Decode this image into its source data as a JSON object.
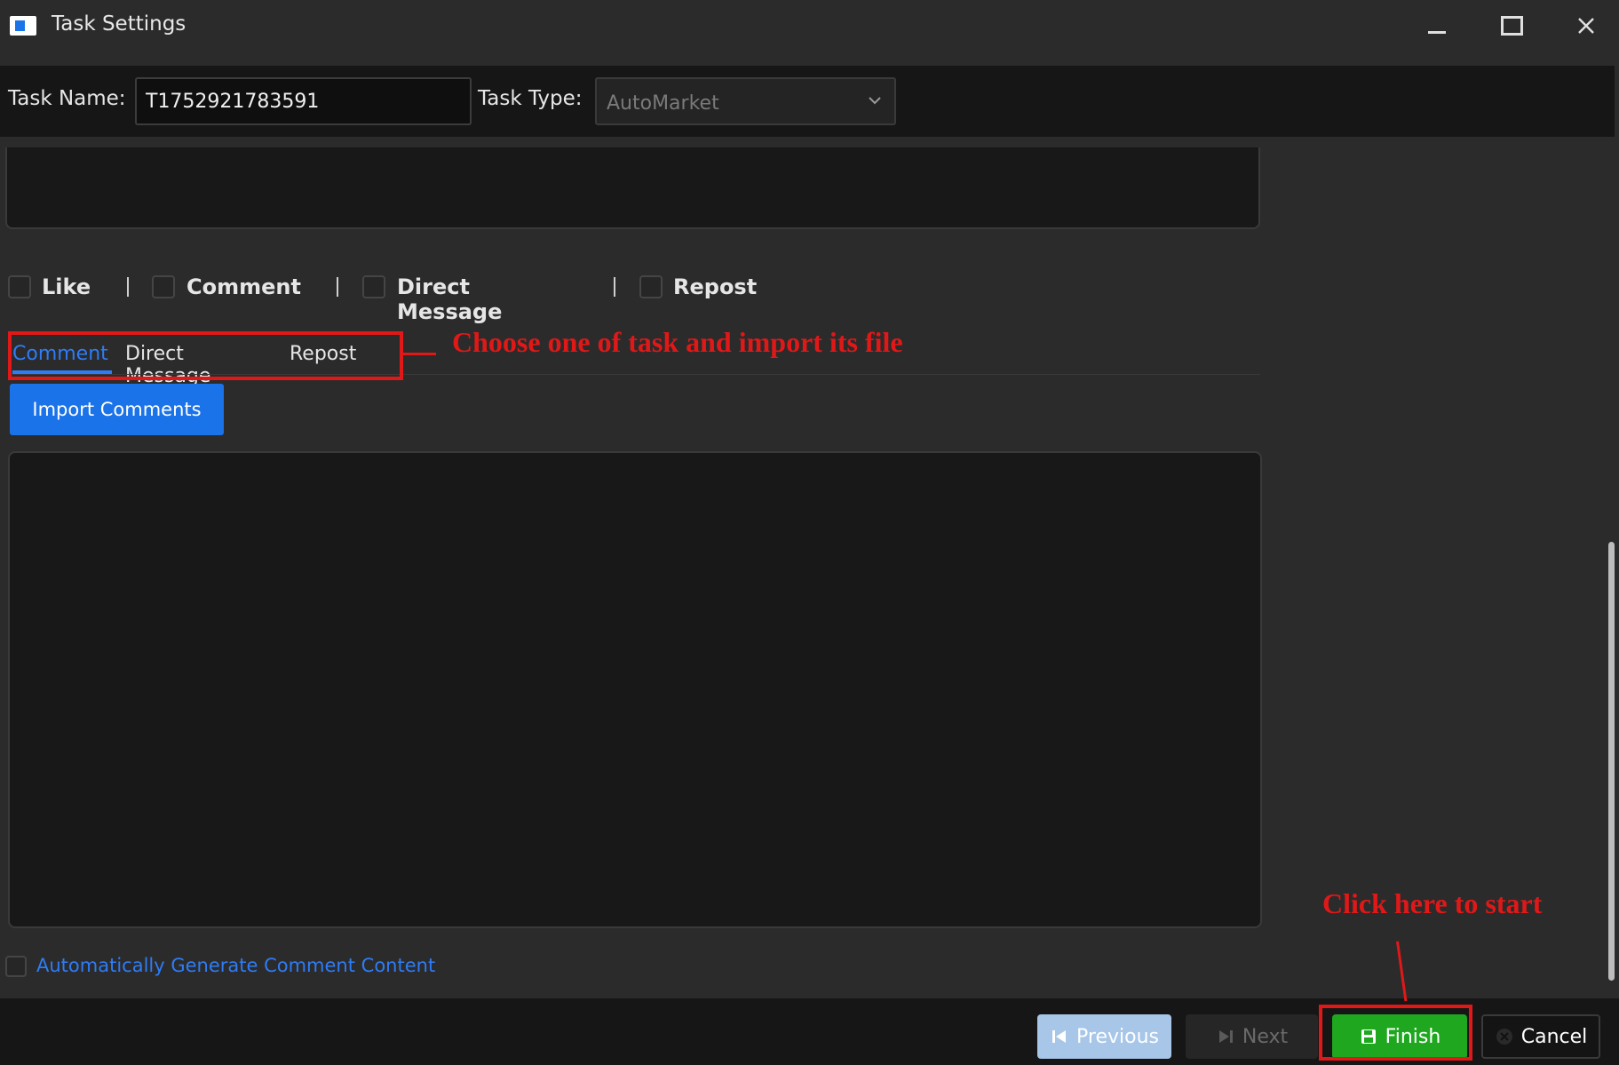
{
  "window": {
    "title": "Task Settings",
    "controls": [
      "minimize",
      "maximize",
      "close"
    ]
  },
  "header": {
    "task_name_label": "Task Name:",
    "task_name_value": "T1752921783591",
    "task_type_label": "Task Type:",
    "task_type_value": "AutoMarket"
  },
  "actions": [
    {
      "label": "Like",
      "checked": false
    },
    {
      "label": "Comment",
      "checked": false
    },
    {
      "label": "Direct Message",
      "checked": false
    },
    {
      "label": "Repost",
      "checked": false
    }
  ],
  "tabs": [
    {
      "label": "Comment",
      "active": true
    },
    {
      "label": "Direct Message",
      "active": false
    },
    {
      "label": "Repost",
      "active": false
    }
  ],
  "import_button": "Import Comments",
  "comments_text": "",
  "auto_generate": {
    "label": "Automatically Generate Comment Content",
    "checked": false
  },
  "footer": {
    "previous": "Previous",
    "next": "Next",
    "finish": "Finish",
    "cancel": "Cancel"
  },
  "annotations": {
    "tabs_note": "Choose one of task and import its file",
    "finish_note": "Click here to start"
  },
  "colors": {
    "accent_blue": "#1a73e8",
    "finish_green": "#1fa81f",
    "annotation_red": "#e01818",
    "background": "#2b2b2b"
  }
}
